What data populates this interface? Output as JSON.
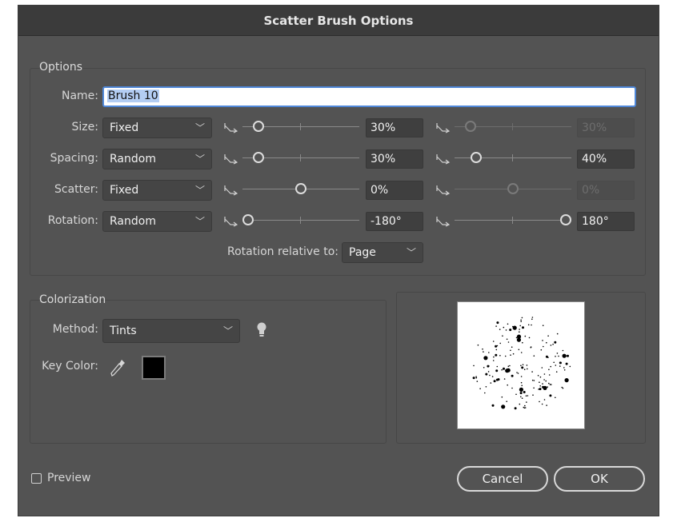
{
  "dialog": {
    "title": "Scatter Brush Options"
  },
  "options": {
    "group_title": "Options",
    "name_label": "Name:",
    "name_value": "Brush 10",
    "rows": [
      {
        "label": "Size:",
        "method": "Fixed",
        "min_value": "30%",
        "max_value": "30%",
        "max_enabled": false
      },
      {
        "label": "Spacing:",
        "method": "Random",
        "min_value": "30%",
        "max_value": "40%",
        "max_enabled": true
      },
      {
        "label": "Scatter:",
        "method": "Fixed",
        "min_value": "0%",
        "max_value": "0%",
        "max_enabled": false
      },
      {
        "label": "Rotation:",
        "method": "Random",
        "min_value": "-180°",
        "max_value": "180°",
        "max_enabled": true
      }
    ],
    "rotation_relative_label": "Rotation relative to:",
    "rotation_relative_value": "Page"
  },
  "colorization": {
    "group_title": "Colorization",
    "method_label": "Method:",
    "method_value": "Tints",
    "key_color_label": "Key Color:",
    "key_color": "#000000"
  },
  "footer": {
    "preview_label": "Preview",
    "preview_checked": false,
    "cancel_label": "Cancel",
    "ok_label": "OK"
  },
  "icons": [
    "pressure-icon",
    "chevron-down-icon",
    "tip-lightbulb-icon",
    "eyedropper-icon"
  ],
  "colors": {
    "dialog_bg": "#535353",
    "title_bg": "#3b3b3b",
    "focus": "#4f87d8"
  }
}
